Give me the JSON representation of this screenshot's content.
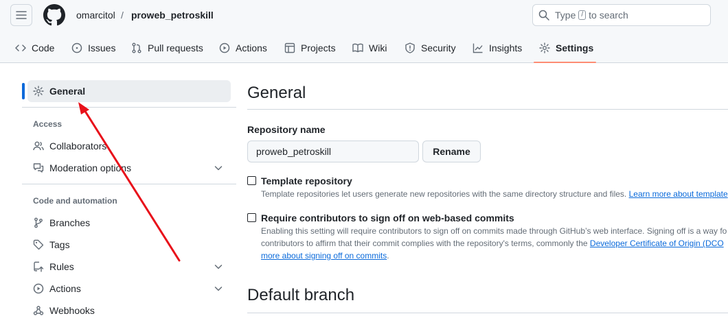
{
  "header": {
    "owner": "omarcitol",
    "separator": "/",
    "repo": "proweb_petroskill",
    "search": {
      "prefix": "Type",
      "key": "/",
      "suffix": "to search"
    }
  },
  "tabs": [
    {
      "label": "Code",
      "icon": "code-icon"
    },
    {
      "label": "Issues",
      "icon": "issue-icon"
    },
    {
      "label": "Pull requests",
      "icon": "pull-request-icon"
    },
    {
      "label": "Actions",
      "icon": "play-icon"
    },
    {
      "label": "Projects",
      "icon": "table-icon"
    },
    {
      "label": "Wiki",
      "icon": "book-icon"
    },
    {
      "label": "Security",
      "icon": "shield-icon"
    },
    {
      "label": "Insights",
      "icon": "graph-icon"
    },
    {
      "label": "Settings",
      "icon": "gear-icon",
      "active": true
    }
  ],
  "sidebar": {
    "general": "General",
    "access_heading": "Access",
    "collaborators": "Collaborators",
    "moderation": "Moderation options",
    "code_heading": "Code and automation",
    "branches": "Branches",
    "tags": "Tags",
    "rules": "Rules",
    "actions": "Actions",
    "webhooks": "Webhooks"
  },
  "main": {
    "title": "General",
    "repo_name_label": "Repository name",
    "repo_name_value": "proweb_petroskill",
    "rename_button": "Rename",
    "template": {
      "title": "Template repository",
      "note": "Template repositories let users generate new repositories with the same directory structure and files.",
      "link": "Learn more about template"
    },
    "signoff": {
      "title": "Require contributors to sign off on web-based commits",
      "note_line1": "Enabling this setting will require contributors to sign off on commits made through GitHub’s web interface. Signing off is a way fo",
      "note_line2": "contributors to affirm that their commit complies with the repository's terms, commonly the",
      "link1": "Developer Certificate of Origin (DCO",
      "link2": "more about signing off on commits",
      "tail": "."
    },
    "default_branch_title": "Default branch"
  },
  "colors": {
    "accent": "#0969da",
    "tab_underline": "#fd8c73",
    "annotation_arrow": "#e8101a"
  }
}
